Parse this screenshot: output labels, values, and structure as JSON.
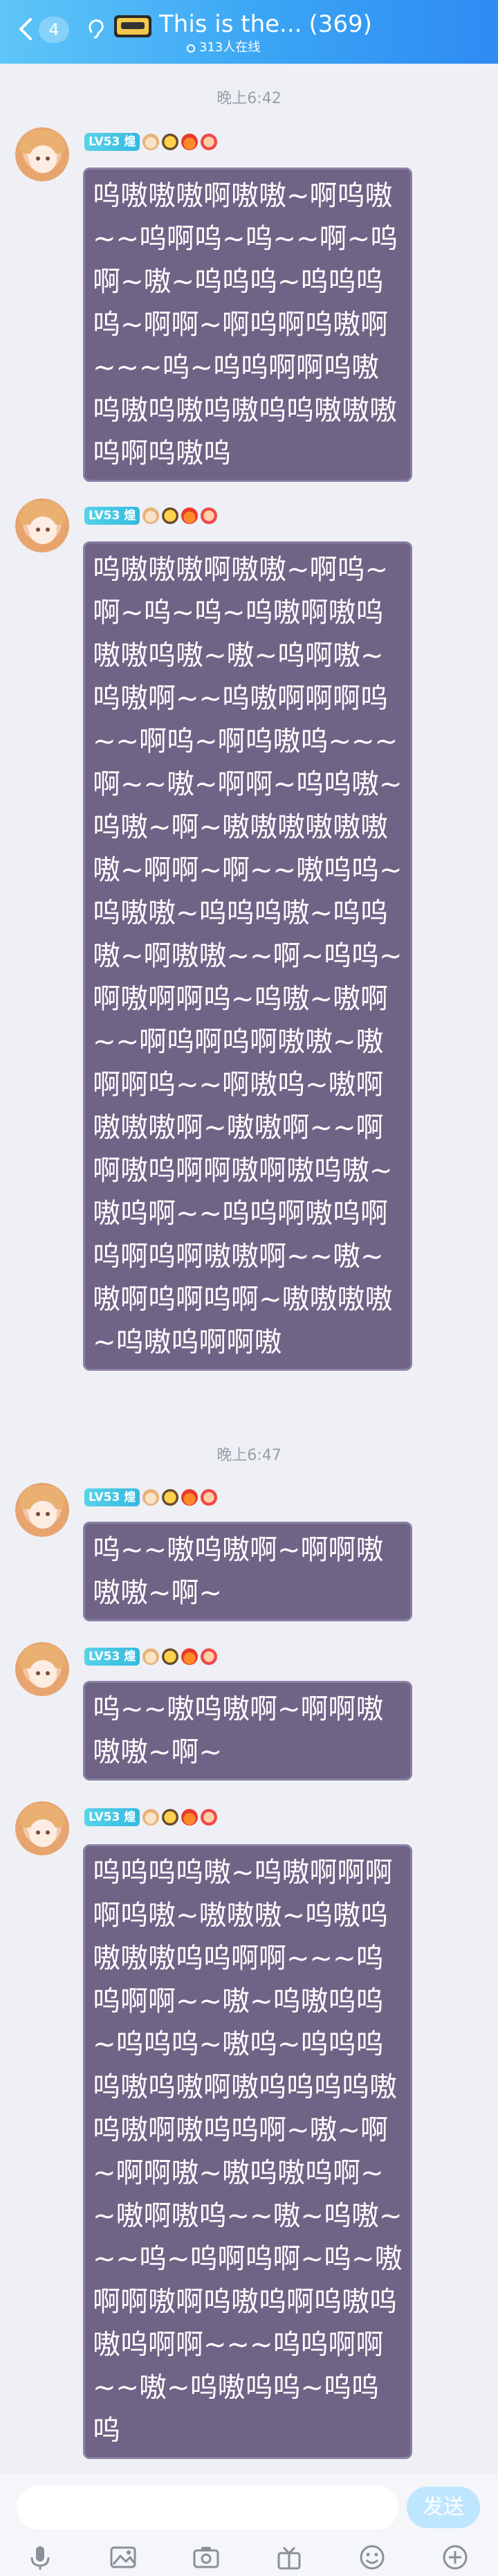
{
  "header": {
    "badge": "4",
    "title": "This is the...",
    "count": "(369)",
    "online": "313人在线"
  },
  "timestamps": [
    "晚上6:42",
    "晚上6:47"
  ],
  "sender": {
    "level": "LV53",
    "name": "煌"
  },
  "messages": [
    {
      "text": "呜嗷嗷嗷啊嗷嗷~啊呜嗷~~呜啊呜~呜~~啊~呜啊~嗷~呜呜呜~呜呜呜呜~啊啊~啊呜啊呜嗷啊~~~呜~呜呜啊啊呜嗷呜嗷呜嗷呜嗷呜呜嗷嗷嗷呜啊呜嗷呜"
    },
    {
      "text": "呜嗷嗷嗷啊嗷嗷~啊呜~啊~呜~呜~呜嗷啊嗷呜嗷嗷呜嗷~嗷~呜啊嗷~呜嗷啊~~呜嗷啊啊啊呜~~啊呜~啊呜嗷呜~~~啊~~嗷~啊啊~呜呜嗷~呜嗷~啊~嗷嗷嗷嗷嗷嗷嗷~啊啊~啊~~嗷呜呜~呜嗷嗷~呜呜呜嗷~呜呜嗷~啊嗷嗷~~啊~呜呜~啊嗷啊啊呜~呜嗷~嗷啊~~啊呜啊呜啊嗷嗷~嗷啊啊呜~~啊嗷呜~嗷啊嗷嗷嗷啊~嗷嗷啊~~啊啊嗷呜啊啊嗷啊嗷呜嗷~嗷呜啊~~呜呜啊嗷呜啊呜啊呜啊嗷嗷啊~~嗷~嗷啊呜啊呜啊~嗷嗷嗷嗷~呜嗷呜啊啊嗷"
    },
    {
      "text": "呜~~嗷呜嗷啊~啊啊嗷嗷嗷~啊~"
    },
    {
      "text": "呜~~嗷呜嗷啊~啊啊嗷嗷嗷~啊~"
    },
    {
      "text": "呜呜呜呜嗷~呜嗷啊啊啊啊呜嗷~嗷嗷嗷~呜嗷呜嗷嗷嗷呜呜啊啊~~~呜呜啊啊~~嗷~呜嗷呜呜~呜呜呜~嗷呜~呜呜呜呜嗷呜嗷啊嗷呜呜呜呜嗷呜嗷啊嗷呜呜啊~嗷~啊~啊啊嗷~嗷呜嗷呜啊~~嗷啊嗷呜~~嗷~呜嗷~~~呜~呜啊呜啊~呜~嗷啊啊嗷啊呜嗷呜啊呜嗷呜嗷呜啊啊~~~呜呜啊啊~~嗷~呜嗷呜呜~呜呜呜"
    }
  ],
  "input": {
    "placeholder": "",
    "send_label": "发送"
  },
  "toolbar": [
    "mic-icon",
    "image-icon",
    "camera-icon",
    "gift-icon",
    "emoji-icon",
    "plus-icon"
  ]
}
